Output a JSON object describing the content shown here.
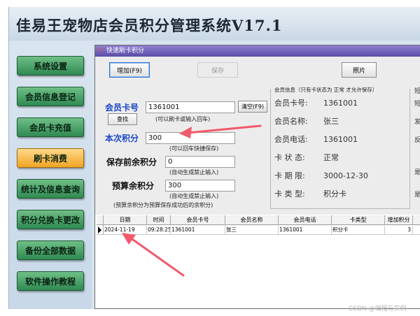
{
  "app": {
    "title": "佳易王宠物店会员积分管理系统V17.1"
  },
  "sidebar": {
    "items": [
      {
        "label": "系统设置"
      },
      {
        "label": "会员信息登记"
      },
      {
        "label": "会员卡充值"
      },
      {
        "label": "刷卡消费"
      },
      {
        "label": "统计及信息查询"
      },
      {
        "label": "积分兑换卡更改"
      },
      {
        "label": "备份全部数据"
      },
      {
        "label": "软件操作教程"
      }
    ],
    "active_index": 3
  },
  "window": {
    "title": "快速刷卡积分"
  },
  "toolbar": {
    "add_label": "增加(F9)",
    "save_label": "保存",
    "photo_label": "照片"
  },
  "form": {
    "card_label": "会员卡号",
    "card_value": "1361001",
    "card_hint": "(可以刷卡或输入回车)",
    "clear_label": "清空(F9)",
    "find_label": "查找",
    "points_label": "本次积分",
    "points_value": "300",
    "points_hint": "(可以回车快捷保存)",
    "prev_label": "保存前余积分",
    "prev_value": "0",
    "prev_hint": "(自动生成禁止输入)",
    "budget_label": "预算余积分",
    "budget_value": "300",
    "budget_hint": "(自动生成禁止输入)",
    "budget_note": "(预算余积分为预算保存成功后的余积分)"
  },
  "info": {
    "header": "会员信息（只有卡状态为 正常 才允许保存）",
    "rows": [
      {
        "key": "会员卡号:",
        "value": "1361001"
      },
      {
        "key": "会员名称:",
        "value": "张三"
      },
      {
        "key": "会员电话:",
        "value": "1361001"
      },
      {
        "key": "卡 状 态:",
        "value": "正常"
      },
      {
        "key": "卡 期 限:",
        "value": "3000-12-30"
      },
      {
        "key": "卡 类 型:",
        "value": "积分卡"
      }
    ],
    "edge_fragments": [
      "短",
      "短",
      "发",
      "反",
      "是",
      "是"
    ]
  },
  "grid": {
    "columns": [
      "日期",
      "时间",
      "会员卡号",
      "会员名称",
      "会员电话",
      "卡类型",
      "增加积分"
    ],
    "rows": [
      [
        "2024-11-19",
        "09:28:25",
        "1361001",
        "张三",
        "1361001",
        "积分卡",
        "3"
      ]
    ]
  },
  "watermark": "CSDN @编程与实例",
  "colors": {
    "nav_green": "#3f9a5f",
    "nav_active": "#f5b03a",
    "title_bar": "#6a5bb8",
    "arrow": "#f05a6a"
  }
}
